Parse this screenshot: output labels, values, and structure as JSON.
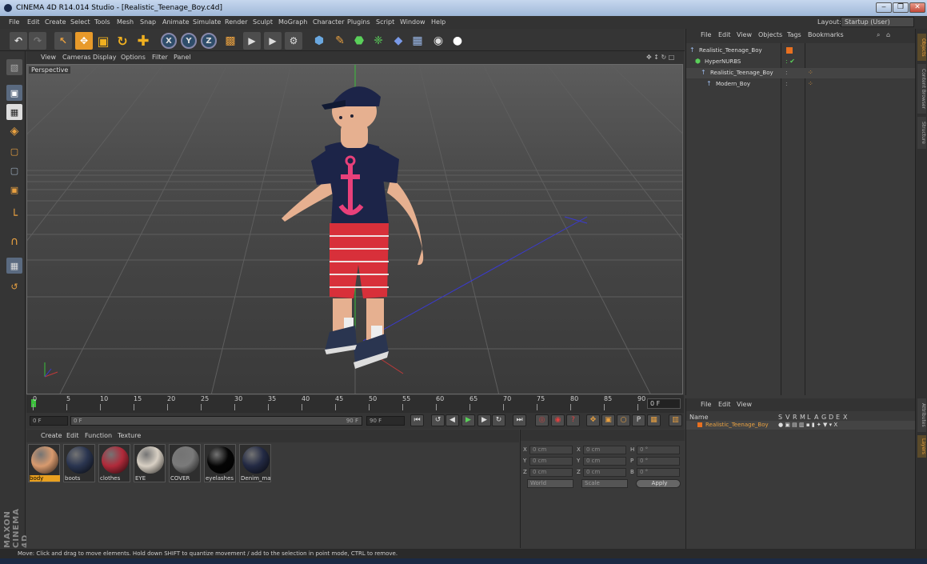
{
  "window": {
    "title": "CINEMA 4D R14.014 Studio - [Realistic_Teenage_Boy.c4d]",
    "controls": [
      "‒",
      "❐",
      "✕"
    ]
  },
  "menubar": {
    "items": [
      "File",
      "Edit",
      "Create",
      "Select",
      "Tools",
      "Mesh",
      "Snap",
      "Animate",
      "Simulate",
      "Render",
      "Sculpt",
      "MoGraph",
      "Character",
      "Plugins",
      "Script",
      "Window",
      "Help"
    ],
    "layout_label": "Layout:",
    "layout_value": "Startup (User)"
  },
  "toolbar": {
    "axes": [
      "X",
      "Y",
      "Z"
    ]
  },
  "viewport": {
    "menu": [
      "View",
      "Cameras",
      "Display",
      "Options",
      "Filter",
      "Panel"
    ],
    "label": "Perspective"
  },
  "timeline": {
    "ticks": [
      "0",
      "5",
      "10",
      "15",
      "20",
      "25",
      "30",
      "35",
      "40",
      "45",
      "50",
      "55",
      "60",
      "65",
      "70",
      "75",
      "80",
      "85",
      "90"
    ],
    "current_frame": "0 F",
    "start_field": "0 F",
    "min_field": "0 F",
    "max_field": "90 F",
    "end_field": "90 F"
  },
  "materials": {
    "menu": [
      "Create",
      "Edit",
      "Function",
      "Texture"
    ],
    "items": [
      {
        "name": "body",
        "color": "#d89a6e"
      },
      {
        "name": "boots",
        "color": "#2a3550"
      },
      {
        "name": "clothes",
        "color": "#b02a3a"
      },
      {
        "name": "EYE",
        "color": "#d8d0c4"
      },
      {
        "name": "COVER",
        "color": "#7a7a7a"
      },
      {
        "name": "eyelashes",
        "color": "#050505"
      },
      {
        "name": "Denim_mat",
        "color": "#232a44"
      }
    ]
  },
  "coordinates": {
    "rows": [
      {
        "a": "X",
        "av": "0 cm",
        "b": "X",
        "bv": "0 cm",
        "c": "H",
        "cv": "0 °"
      },
      {
        "a": "Y",
        "av": "0 cm",
        "b": "Y",
        "bv": "0 cm",
        "c": "P",
        "cv": "0 °"
      },
      {
        "a": "Z",
        "av": "0 cm",
        "b": "Z",
        "bv": "0 cm",
        "c": "B",
        "cv": "0 °"
      }
    ],
    "mode1": "World",
    "mode2": "Scale",
    "apply": "Apply"
  },
  "objects": {
    "menu": [
      "File",
      "Edit",
      "View",
      "Objects",
      "Tags",
      "Bookmarks"
    ],
    "tree": [
      {
        "name": "Realistic_Teenage_Boy",
        "indent": 0
      },
      {
        "name": "HyperNURBS",
        "indent": 1
      },
      {
        "name": "Realistic_Teenage_Boy",
        "indent": 2
      },
      {
        "name": "Modern_Boy",
        "indent": 3
      }
    ]
  },
  "attributes": {
    "menu": [
      "File",
      "Edit",
      "View"
    ],
    "name_header": "Name",
    "columns": [
      "S",
      "V",
      "R",
      "M",
      "L",
      "A",
      "G",
      "D",
      "E",
      "X"
    ],
    "row": "Realistic_Teenage_Boy"
  },
  "side_tabs": [
    "Objects",
    "Content Browser",
    "Structure",
    "Attributes",
    "Layers"
  ],
  "status": "Move: Click and drag to move elements. Hold down SHIFT to quantize movement / add to the selection in point mode, CTRL to remove.",
  "branding": "MAXON CINEMA 4D"
}
